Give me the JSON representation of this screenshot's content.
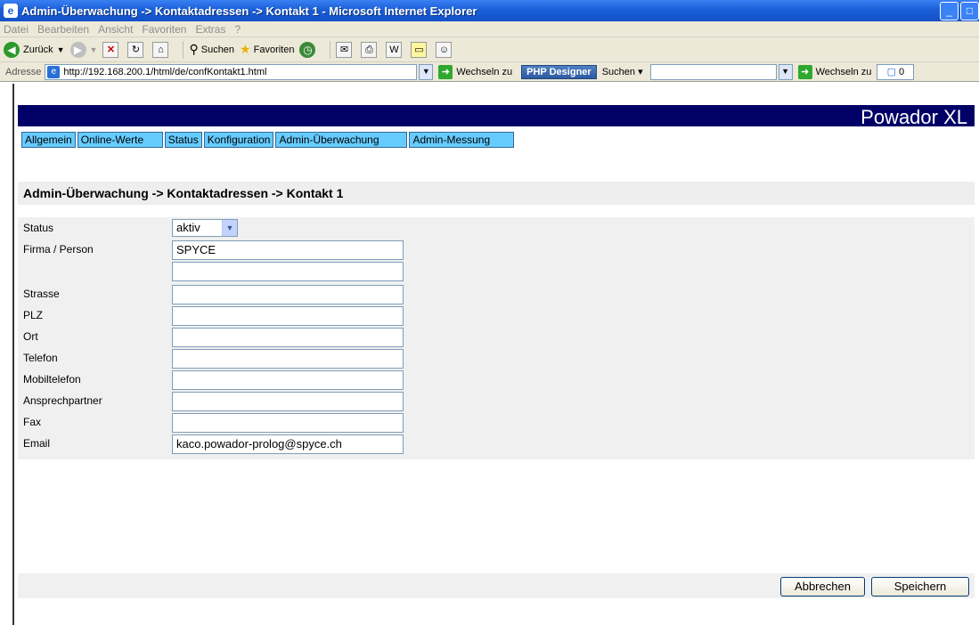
{
  "window": {
    "title": "Admin-Überwachung -> Kontaktadressen -> Kontakt 1 - Microsoft Internet Explorer"
  },
  "menu": [
    "Datei",
    "Bearbeiten",
    "Ansicht",
    "Favoriten",
    "Extras",
    "?"
  ],
  "toolbar": {
    "back_label": "Zurück",
    "search_label": "Suchen",
    "favorites_label": "Favoriten"
  },
  "addressbar": {
    "label": "Adresse",
    "url": "http://192.168.200.1/html/de/confKontakt1.html",
    "go_label": "Wechseln zu",
    "php_designer": "PHP Designer",
    "search_label": "Suchen",
    "go_label_2": "Wechseln zu",
    "counter": "0"
  },
  "page": {
    "brand": "Powador XL",
    "tabs": [
      "Allgemein",
      "Online-Werte",
      "Status",
      "Konfiguration",
      "Admin-Überwachung",
      "Admin-Messung"
    ],
    "title": "Admin-Überwachung -> Kontaktadressen -> Kontakt 1",
    "form": {
      "status_label": "Status",
      "status_value": "aktiv",
      "firma_label": "Firma / Person",
      "firma_value": "SPYCE",
      "firma2_value": "",
      "strasse_label": "Strasse",
      "plz_label": "PLZ",
      "ort_label": "Ort",
      "telefon_label": "Telefon",
      "mobil_label": "Mobiltelefon",
      "ansprech_label": "Ansprechpartner",
      "fax_label": "Fax",
      "email_label": "Email",
      "email_value": "kaco.powador-prolog@spyce.ch"
    },
    "buttons": {
      "cancel": "Abbrechen",
      "save": "Speichern"
    }
  }
}
